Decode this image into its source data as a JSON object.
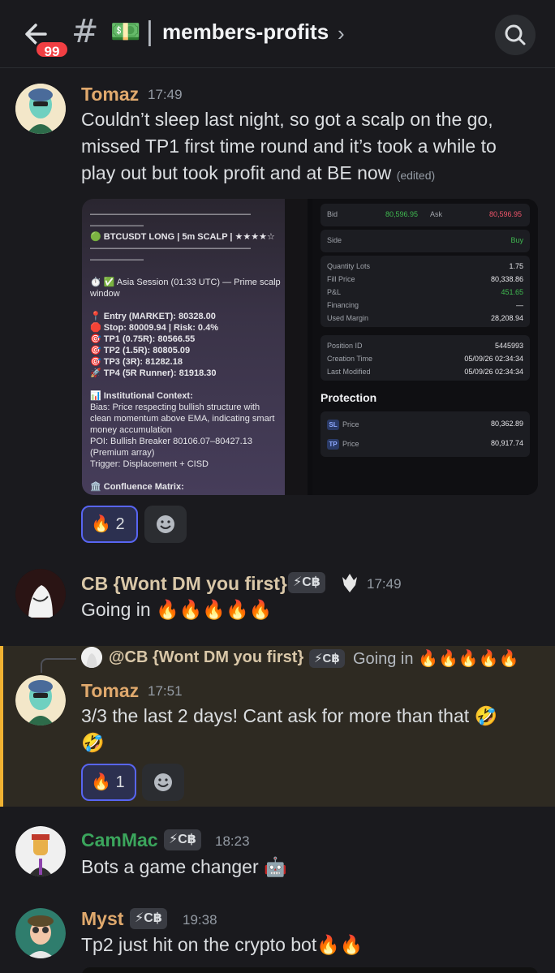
{
  "header": {
    "badge_count": "99",
    "channel_hash": "#",
    "channel_emoji": "💵",
    "separator": "|",
    "channel_name": "members-profits",
    "chevron": "›"
  },
  "messages": [
    {
      "author": "Tomaz",
      "author_color": "#e0a96d",
      "time": "17:49",
      "text": "Couldn’t sleep last night, so got a scalp on the go, missed TP1 first time round and it’s took a while to play out but took profit and at BE now",
      "edited": "(edited)",
      "embed": {
        "signal_lines": [
          "——————————————————",
          "——————",
          "🟢 BTCUSDT LONG | 5m SCALP | ★★★★☆",
          "——————————————————",
          "——————",
          "",
          "⏱️ ✅ Asia Session (01:33 UTC) — Prime scalp",
          "window",
          "",
          "📍 Entry (MARKET): 80328.00",
          "🛑 Stop: 80009.94 | Risk: 0.4%",
          "🎯 TP1 (0.75R): 80566.55",
          "🎯 TP2 (1.5R): 80805.09",
          "🎯 TP3 (3R): 81282.18",
          "🚀 TP4 (5R Runner): 81918.30",
          "",
          "📊 Institutional Context:",
          "  Bias: Price respecting bullish structure with",
          "clean momentum above EMA, indicating smart",
          "money accumulation",
          "  POI: Bullish Breaker 80106.07–80427.13",
          "(Premium array)",
          "  Trigger: Displacement + CISD",
          "",
          "🏛️ Confluence Matrix:"
        ],
        "bid_label": "Bid",
        "bid_value": "80,596.95",
        "ask_label": "Ask",
        "ask_value": "80,596.95",
        "side_label": "Side",
        "side_value": "Buy",
        "details": [
          {
            "label": "Quantity Lots",
            "value": "1.75"
          },
          {
            "label": "Fill Price",
            "value": "80,338.86"
          },
          {
            "label": "P&L",
            "value": "451.65"
          },
          {
            "label": "Financing",
            "value": "—"
          },
          {
            "label": "Used Margin",
            "value": "28,208.94"
          }
        ],
        "position": [
          {
            "label": "Position ID",
            "value": "5445993"
          },
          {
            "label": "Creation Time",
            "value": "05/09/26 02:34:34"
          },
          {
            "label": "Last Modified",
            "value": "05/09/26 02:34:34"
          }
        ],
        "protection_title": "Protection",
        "protection": [
          {
            "chip": "SL",
            "label": "Price",
            "value": "80,362.89"
          },
          {
            "chip": "TP",
            "label": "Price",
            "value": "80,917.74"
          }
        ]
      },
      "reaction": {
        "emoji": "🔥",
        "count": "2"
      }
    },
    {
      "author": "CB {Wont DM you first}",
      "author_color": "#d9c7a8",
      "tag": "⚡C฿",
      "time": "17:49",
      "text": "Going in 🔥🔥🔥🔥🔥"
    },
    {
      "reply_author": "@CB {Wont DM you first}",
      "reply_tag": "⚡C฿",
      "reply_text": "Going in 🔥🔥🔥🔥🔥",
      "author": "Tomaz",
      "author_color": "#e0a96d",
      "time": "17:51",
      "text": "3/3 the last 2 days! Cant ask for more than that 🤣 🤣",
      "reaction": {
        "emoji": "🔥",
        "count": "1"
      }
    },
    {
      "author": "CamMac",
      "author_color": "#3ba55c",
      "tag": "⚡C฿",
      "time": "18:23",
      "text": "Bots a game changer 🤖"
    },
    {
      "author": "Myst",
      "author_color": "#e0a96d",
      "tag": "⚡C฿",
      "time": "19:38",
      "text": "Tp2 just hit on the crypto bot🔥🔥"
    }
  ]
}
